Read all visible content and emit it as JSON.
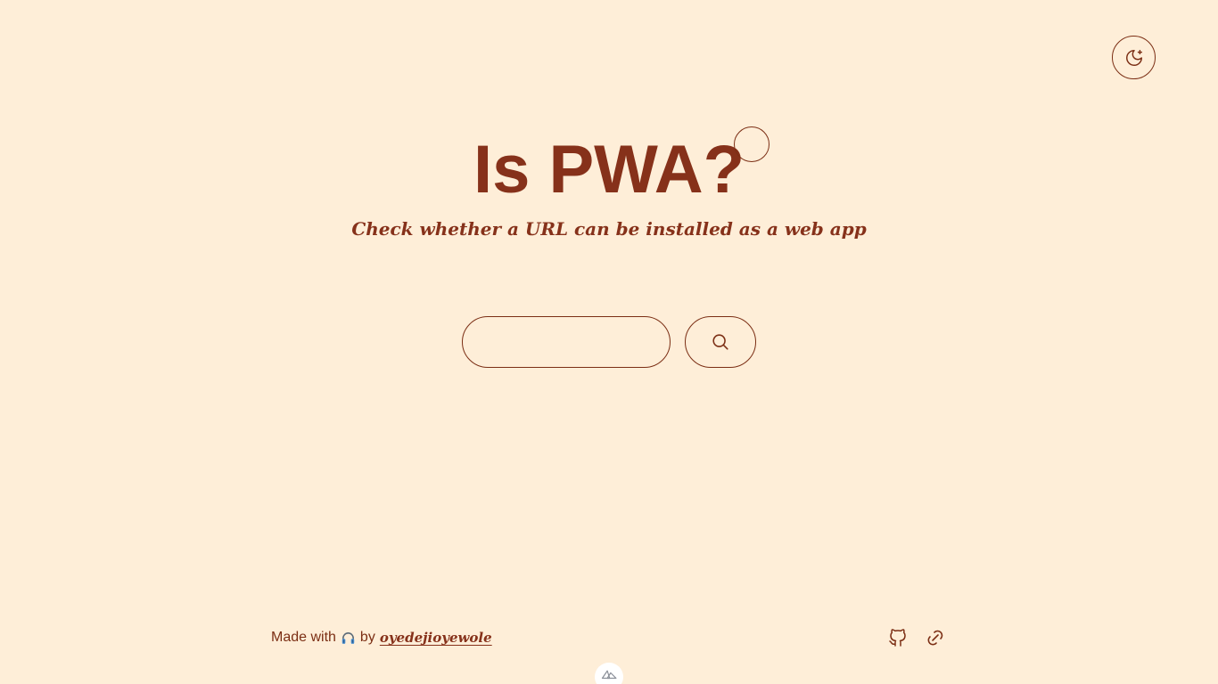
{
  "header": {
    "theme_toggle_icon": "moon-stars-icon"
  },
  "hero": {
    "title": "Is PWA?",
    "subtitle": "Check whether a URL can be installed as a web app"
  },
  "search": {
    "input_value": "",
    "placeholder": "",
    "button_icon": "search-icon"
  },
  "footer": {
    "made_with": "Made with",
    "emoji_icon": "headphones-icon",
    "by": "by",
    "author": "oyedejioyewole",
    "github_icon": "github-icon",
    "share_icon": "link-icon"
  },
  "devtools": {
    "icon": "nuxt-icon"
  },
  "colors": {
    "background": "#feeed8",
    "accent": "#86311a"
  }
}
